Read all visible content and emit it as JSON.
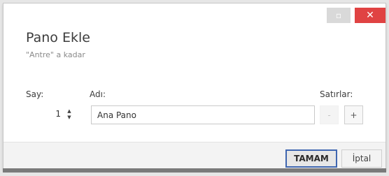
{
  "window": {
    "minimize_icon": "minimize-icon",
    "minimize_glyph": "▫",
    "close_icon": "close-icon",
    "close_glyph": "✕"
  },
  "dialog": {
    "title": "Pano Ekle",
    "subtitle": "\"Antre\" a kadar"
  },
  "fields": {
    "count_label": "Say:",
    "count_value": "1",
    "name_label": "Adı:",
    "name_value": "Ana Pano",
    "rows_label": "Satırlar:",
    "minus_label": "-",
    "plus_label": "+"
  },
  "buttons": {
    "ok": "TAMAM",
    "cancel": "İptal"
  },
  "colors": {
    "close_button": "#e04343",
    "ok_border": "#3f66b0"
  }
}
